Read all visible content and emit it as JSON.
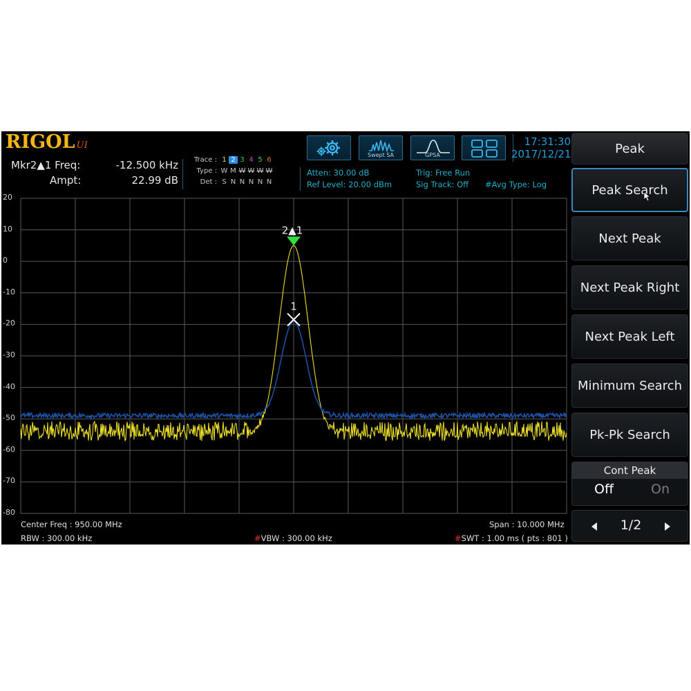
{
  "brand": {
    "name": "RIGOL",
    "model": "UI"
  },
  "marker": {
    "freq_label": "Mkr2▲1 Freq:",
    "freq_value": "-12.500 kHz",
    "ampt_label": "Ampt:",
    "ampt_value": "22.99 dB"
  },
  "trace_panel": {
    "trace_label": "Trace :",
    "type_label": "Type :",
    "det_label": "Det :",
    "trace_numbers": [
      "1",
      "2",
      "3",
      "4",
      "5",
      "6"
    ],
    "trace_colors": [
      "#f2e20c",
      "#2a8fe0",
      "#2fd04a",
      "#d040d0",
      "#2fd04a",
      "#f07020"
    ],
    "selected_trace": "2",
    "types": [
      "W",
      "M",
      "W",
      "W",
      "W",
      "W"
    ],
    "dets": [
      "S",
      "N",
      "N",
      "N",
      "N",
      "N"
    ]
  },
  "settings": {
    "atten": "Atten: 30.00 dB",
    "ref_level": "Ref Level: 20.00 dBm",
    "trig": "Trig: Free Run",
    "sig_track": "Sig Track: Off",
    "avg_type": "#Avg Type: Log"
  },
  "mode_buttons": [
    {
      "icon": "gear-icon",
      "caption": ""
    },
    {
      "icon": "swept-sa-icon",
      "caption": "Swept SA"
    },
    {
      "icon": "gpsa-icon",
      "caption": "GPSA"
    },
    {
      "icon": "window-layout-icon",
      "caption": ""
    }
  ],
  "clock": {
    "time": "17:31:30",
    "date": "2017/12/21"
  },
  "plot": {
    "y_ticks": [
      "20",
      "10",
      "0",
      "-10",
      "-20",
      "-30",
      "-40",
      "-50",
      "-60",
      "-70",
      "-80"
    ],
    "marker1_label": "1",
    "marker2_label": "2▲1",
    "colors": {
      "trace_yellow": "#ecdf2a",
      "trace_blue": "#1d4fa0",
      "marker_green": "#2fe040"
    }
  },
  "bottom": {
    "center_freq": "Center Freq : 950.00 MHz",
    "span": "Span : 10.000 MHz",
    "rbw": "RBW : 300.00 kHz",
    "vbw": "VBW : 300.00 kHz",
    "swt": "SWT : 1.00 ms ( pts : 801 )",
    "vbw_flag": "#",
    "swt_flag": "#"
  },
  "softkeys": {
    "title": "Peak",
    "items": [
      "Peak Search",
      "Next Peak",
      "Next Peak Right",
      "Next Peak Left",
      "Minimum Search",
      "Pk-Pk Search"
    ],
    "cont_peak": {
      "label": "Cont Peak",
      "off": "Off",
      "on": "On",
      "selected": "Off"
    },
    "page": "1/2"
  }
}
